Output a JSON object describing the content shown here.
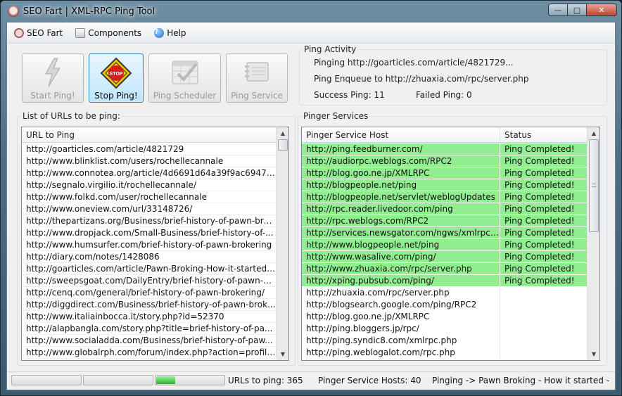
{
  "window": {
    "title": "SEO Fart | XML-RPC Ping Tool",
    "controls": {
      "minimize": "—",
      "maximize": "□",
      "close": "✕"
    }
  },
  "menu": {
    "items": [
      "SEO Fart",
      "Components",
      "Help"
    ]
  },
  "toolbar": {
    "start": "Start Ping!",
    "stop": "Stop Ping!",
    "scheduler": "Ping Scheduler",
    "service": "Ping Service",
    "stop_sign_text": "STOP"
  },
  "activity": {
    "group_label": "Ping Activity",
    "pinging": "Pinging http://goarticles.com/article/4821729...",
    "enqueue": "Ping Enqueue to http://zhuaxia.com/rpc/server.php",
    "success": "Success Ping: 11",
    "failed": "Failed Ping: 0"
  },
  "urls": {
    "group_label": "List of URLs to be ping:",
    "column": "URL to Ping",
    "rows": [
      "http://goarticles.com/article/4821729",
      "http://www.blinklist.com/users/rochellecannale",
      "http://www.connotea.org/article/4d6691d64a39f9ac69471...",
      "http://segnalo.virgilio.it/rochellecannale/",
      "http://www.folkd.com/user/rochellecannale",
      "http://www.oneview.com/url/33148726/",
      "http://thepartizans.org/Business/brief-history-of-pawn-bro...",
      "http://www.dropjack.com/Small-Business/brief-history-of-...",
      "http://www.humsurfer.com/brief-history-of-pawn-brokering",
      "http://diary.com/notes/1428086",
      "http://goarticles.com/article/Pawn-Broking-How-it-started/...",
      "http://sweepsgoat.com/DailyEntry/brief-history-of-pawn-b...",
      "http://cenq.com/general/brief-history-of-pawn-brokering/",
      "http://diggdirect.com/Business/brief-history-of-pawn-brok...",
      "http://www.italiainbocca.it/story.php?id=52370",
      "http://alapbangla.com/story.php?title=brief-history-of-pa...",
      "http://www.socialadda.com/Business/brief-history-of-paw...",
      "http://www.globalrph.com/forum/index.php?action=profile..."
    ]
  },
  "services": {
    "group_label": "Pinger Services",
    "columns": [
      "Pinger Service Host",
      "Status"
    ],
    "rows": [
      {
        "host": "http://ping.feedburner.com/",
        "status": "Ping Completed!"
      },
      {
        "host": "http://audiorpc.weblogs.com/RPC2",
        "status": "Ping Completed!"
      },
      {
        "host": "http://blog.goo.ne.jp/XMLRPC",
        "status": "Ping Completed!"
      },
      {
        "host": "http://blogpeople.net/ping",
        "status": "Ping Completed!"
      },
      {
        "host": "http://blogpeople.net/servlet/weblogUpdates",
        "status": "Ping Completed!"
      },
      {
        "host": "http://rpc.reader.livedoor.com/ping",
        "status": "Ping Completed!"
      },
      {
        "host": "http://rpc.weblogs.com/RPC2",
        "status": "Ping Completed!"
      },
      {
        "host": "http://services.newsgator.com/ngws/xmlrpcpi...",
        "status": "Ping Completed!"
      },
      {
        "host": "http://www.blogpeople.net/ping",
        "status": "Ping Completed!"
      },
      {
        "host": "http://www.wasalive.com/ping/",
        "status": "Ping Completed!"
      },
      {
        "host": "http://www.zhuaxia.com/rpc/server.php",
        "status": "Ping Completed!"
      },
      {
        "host": "http://xping.pubsub.com/ping/",
        "status": "Ping Completed!"
      },
      {
        "host": "http://zhuaxia.com/rpc/server.php",
        "status": ""
      },
      {
        "host": "http://blogsearch.google.com/ping/RPC2",
        "status": ""
      },
      {
        "host": "http://blog.goo.ne.jp/XMLRPC",
        "status": ""
      },
      {
        "host": "http://ping.bloggers.jp/rpc/",
        "status": ""
      },
      {
        "host": "http://ping.syndic8.com/xmlrpc.php",
        "status": ""
      },
      {
        "host": "http://ping.weblogalot.com/rpc.php",
        "status": ""
      }
    ]
  },
  "status": {
    "progress": [
      0,
      0,
      0.28
    ],
    "urls_to_ping": "URLs to ping: 365",
    "pinger_hosts": "Pinger Service Hosts: 40",
    "current": "Pinging -> Pawn Broking - How it started - Fina"
  },
  "colors": {
    "completed_row": "#90ee90",
    "accent_button": "#bee6fd"
  }
}
